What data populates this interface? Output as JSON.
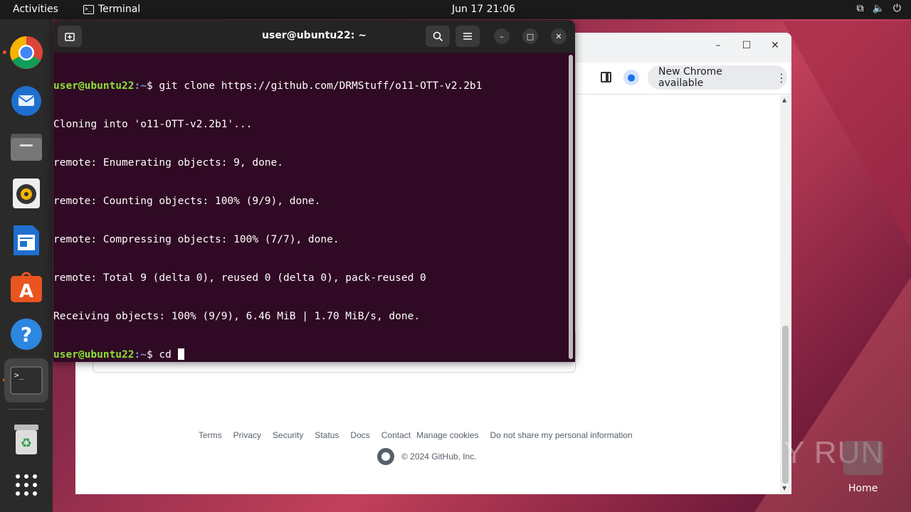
{
  "topbar": {
    "activities": "Activities",
    "app_name": "Terminal",
    "clock": "Jun 17  21:06"
  },
  "dock": {
    "items": [
      "chrome",
      "thunderbird",
      "files",
      "rhythmbox",
      "libreoffice-writer",
      "app-center",
      "help",
      "terminal",
      "trash",
      "show-apps"
    ]
  },
  "terminal": {
    "title": "user@ubuntu22: ~",
    "prompt_user": "user@ubuntu22",
    "prompt_path": ":~",
    "prompt_symbol": "$",
    "command1": " git clone https://github.com/DRMStuff/o11-OTT-v2.2b1",
    "output": [
      "Cloning into 'o11-OTT-v2.2b1'...",
      "remote: Enumerating objects: 9, done.",
      "remote: Counting objects: 100% (9/9), done.",
      "remote: Compressing objects: 100% (7/7), done.",
      "remote: Total 9 (delta 0), reused 0 (delta 0), pack-reused 0",
      "Receiving objects: 100% (9/9), 6.46 MiB | 1.70 MiB/s, done."
    ],
    "command2": " cd "
  },
  "chrome": {
    "update_label": "New Chrome available",
    "footer_links": [
      "Terms",
      "Privacy",
      "Security",
      "Status",
      "Docs",
      "Contact",
      "Manage cookies",
      "Do not share my personal information"
    ],
    "copyright": "© 2024 GitHub, Inc."
  },
  "desktop": {
    "watermark": "ANY RUN",
    "home_label": "Home"
  }
}
